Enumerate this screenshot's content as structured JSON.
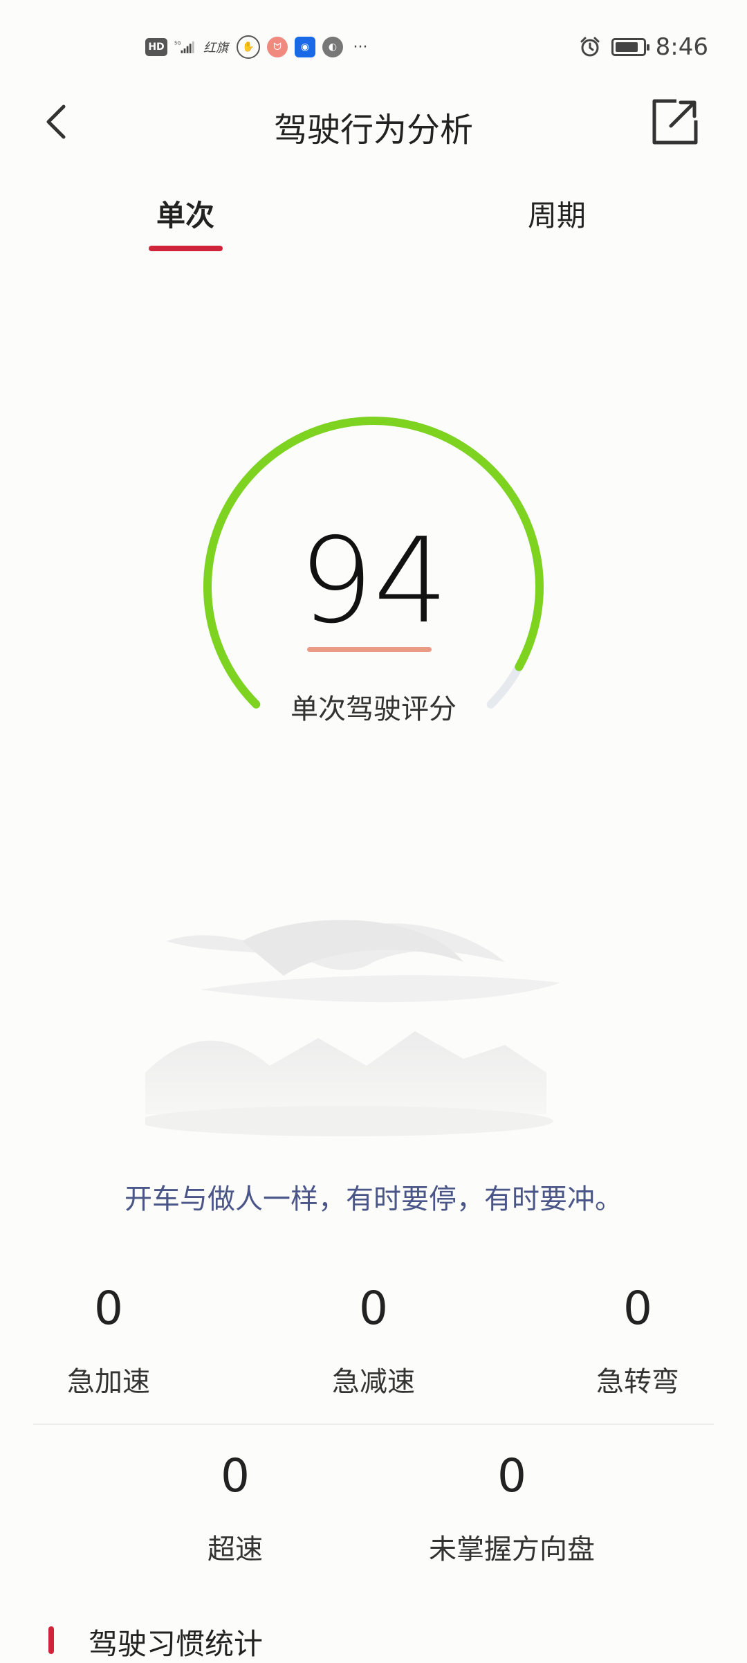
{
  "status_bar": {
    "left_icons": [
      "hd-icon",
      "5g-signal-icon",
      "hongqi-icon",
      "hand-icon",
      "red-app-icon",
      "blue-app-icon",
      "grey-app-icon",
      "more-dots-icon"
    ],
    "hd": "HD",
    "signal": "5G",
    "brand": "红旗",
    "more": "···",
    "time": "8:46"
  },
  "header": {
    "title": "驾驶行为分析"
  },
  "tabs": [
    {
      "label": "单次",
      "active": true
    },
    {
      "label": "周期",
      "active": false
    }
  ],
  "gauge": {
    "score": "94",
    "label": "单次驾驶评分",
    "fraction": 0.94,
    "colors": {
      "active": "#7ed321",
      "track": "#e6e9ee"
    }
  },
  "quote": "开车与做人一样，有时要停，有时要冲。",
  "stats": [
    {
      "value": "0",
      "label": "急加速"
    },
    {
      "value": "0",
      "label": "急减速"
    },
    {
      "value": "0",
      "label": "急转弯"
    },
    {
      "value": "0",
      "label": "超速"
    },
    {
      "value": "0",
      "label": "未掌握方向盘"
    }
  ],
  "section": {
    "title": "驾驶习惯统计"
  },
  "colors": {
    "accent": "#d0243a",
    "quote": "#4a5588"
  }
}
